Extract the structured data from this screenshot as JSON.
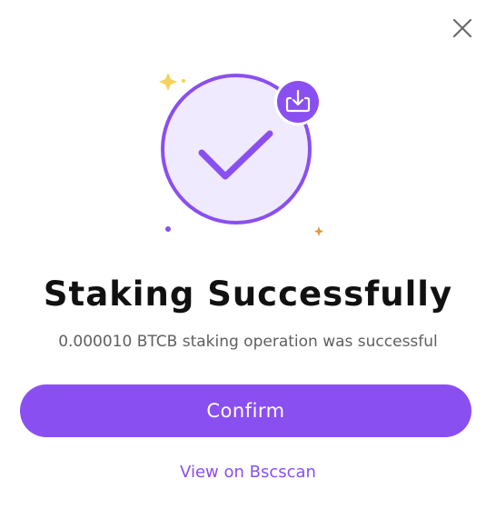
{
  "dialog": {
    "title": "Staking Successfully",
    "message": "0.000010 BTCB staking operation was successful",
    "confirm_label": "Confirm",
    "link_label": "View on Bscscan"
  },
  "icons": {
    "close": "close-icon",
    "success": "checkmark-icon",
    "badge": "download-icon",
    "sparkle": "sparkle-icon"
  },
  "colors": {
    "accent": "#8a4ff0",
    "circle_fill": "#efeafd",
    "sparkle_yellow": "#f3d35a",
    "sparkle_orange": "#e0993a",
    "text_primary": "#111111",
    "text_secondary": "#5f5f5f"
  }
}
